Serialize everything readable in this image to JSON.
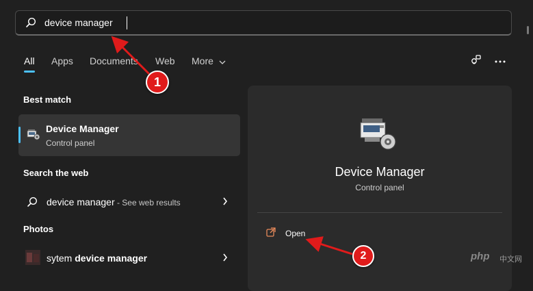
{
  "search": {
    "value": "device manager"
  },
  "tabs": [
    {
      "label": "All"
    },
    {
      "label": "Apps"
    },
    {
      "label": "Documents"
    },
    {
      "label": "Web"
    },
    {
      "label": "More"
    }
  ],
  "sections": {
    "best_match": "Best match",
    "search_web": "Search the web",
    "photos": "Photos"
  },
  "best_match": {
    "title": "Device Manager",
    "subtitle": "Control panel"
  },
  "web_result": {
    "query": "device manager",
    "suffix": " - See web results"
  },
  "photo_result": {
    "prefix": "sytem ",
    "bold": "device manager"
  },
  "detail": {
    "title": "Device Manager",
    "subtitle": "Control panel",
    "open_label": "Open"
  },
  "annotations": {
    "step1": "1",
    "step2": "2"
  },
  "watermark": {
    "text": "php",
    "sub": "中文网"
  },
  "colors": {
    "accent": "#4cc2ff",
    "annotation_red": "#e01b1b",
    "open_icon": "#e98a5a"
  },
  "icons": [
    "search-icon",
    "chevron-down-icon",
    "share-icon",
    "more-icon",
    "device-manager-icon",
    "chevron-right-icon",
    "open-external-icon"
  ]
}
